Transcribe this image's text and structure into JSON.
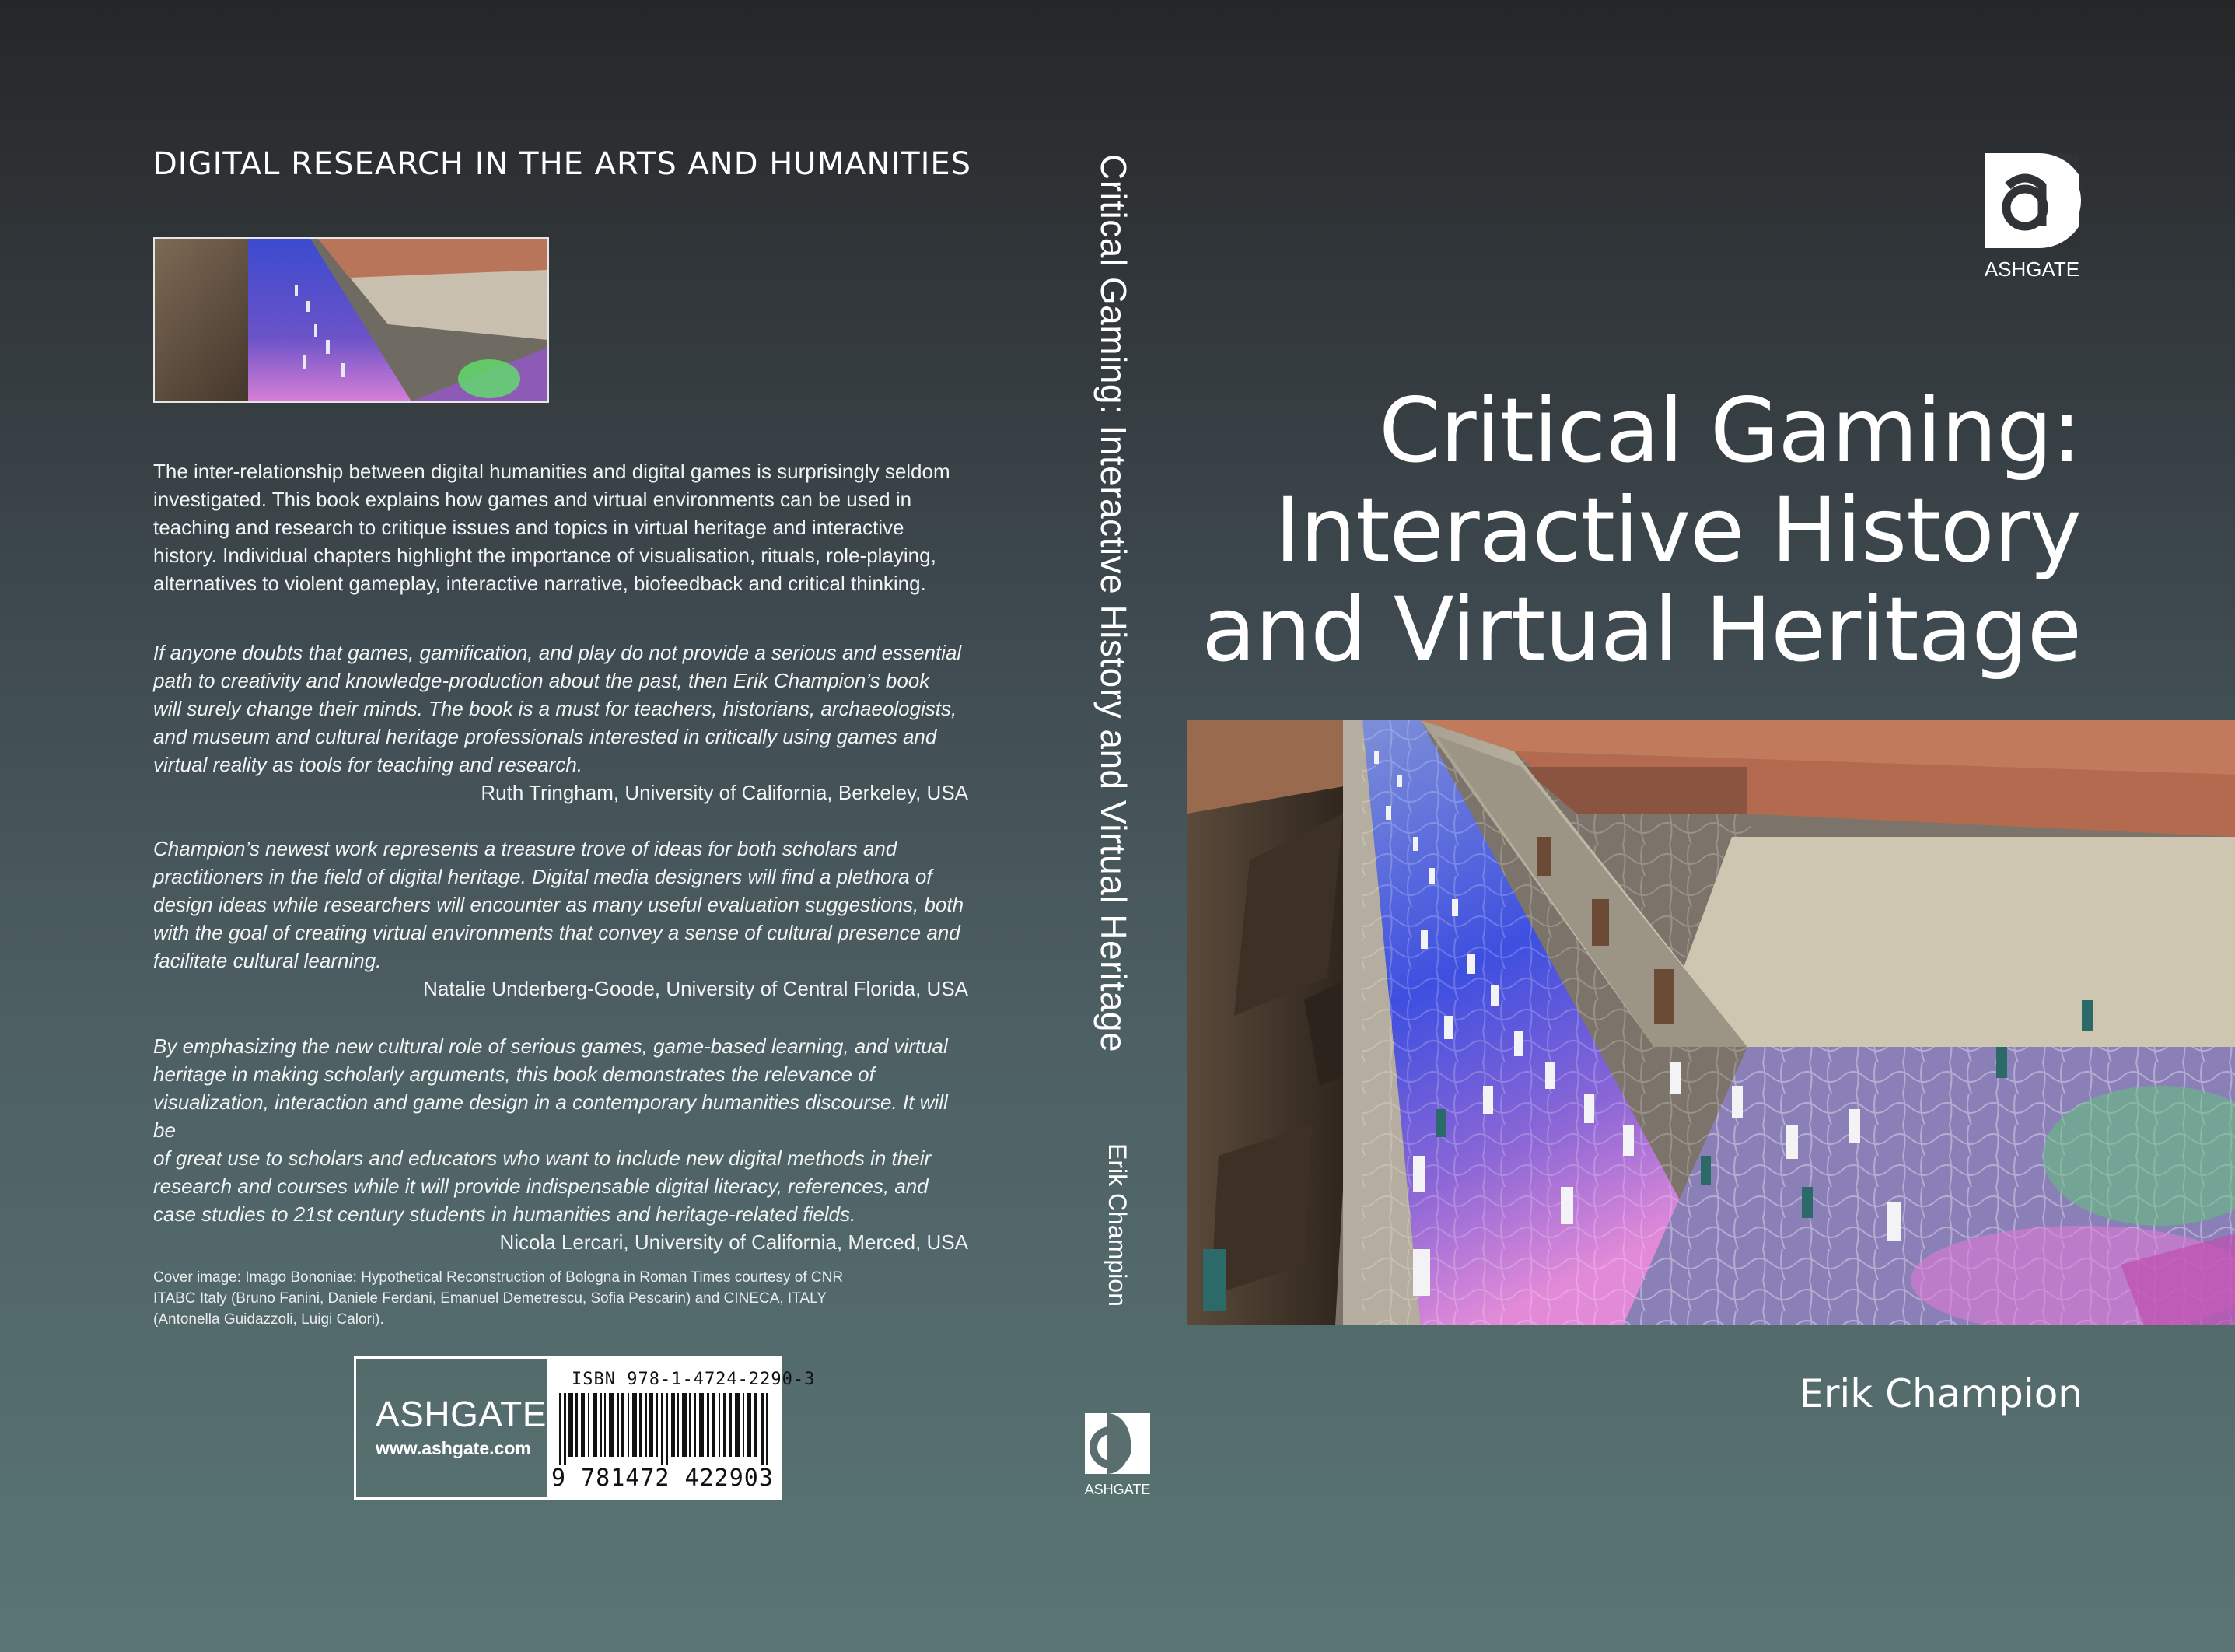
{
  "back": {
    "series": "DIGITAL RESEARCH IN THE ARTS AND HUMANITIES",
    "intro_lines": [
      "The inter-relationship between digital humanities and digital games is surprisingly seldom",
      "investigated. This book explains how games and virtual environments can be used in",
      "teaching and research to critique issues and topics in virtual heritage and interactive",
      "history. Individual chapters highlight the importance of visualisation, rituals, role-playing,",
      "alternatives to violent gameplay, interactive narrative, biofeedback and critical thinking."
    ],
    "quotes": [
      {
        "lines": [
          "If anyone doubts that games, gamification, and play do not provide a serious and essential",
          "path to creativity and knowledge-production about the past, then Erik Champion’s book",
          "will surely change their minds. The book is a must for teachers, historians, archaeologists,",
          "and museum and cultural heritage professionals interested in critically using games and",
          "virtual reality as tools for teaching and research."
        ],
        "attribution": "Ruth Tringham, University of California, Berkeley, USA"
      },
      {
        "lines": [
          "Champion’s newest work represents a treasure trove of ideas for both scholars and",
          "practitioners in the field of digital heritage. Digital media designers will find a plethora of",
          "design ideas while researchers will encounter as many useful evaluation suggestions, both",
          "with the goal of creating virtual environments that convey a sense of cultural presence and",
          "facilitate cultural learning."
        ],
        "attribution": "Natalie Underberg-Goode, University of Central Florida, USA"
      },
      {
        "lines": [
          "By emphasizing the new cultural role of serious games, game-based learning, and virtual",
          "heritage in making scholarly arguments, this book demonstrates the relevance of",
          "visualization, interaction and game design in a contemporary humanities discourse. It will be",
          "of great use to scholars and educators who want to include new digital methods in their",
          "research and courses while it will provide indispensable digital literacy, references, and",
          "case studies to 21st century students in humanities and heritage-related fields."
        ],
        "attribution": "Nicola Lercari, University of California, Merced, USA"
      }
    ],
    "credit_lines": [
      "Cover image: Imago Bononiae: Hypothetical Reconstruction of Bologna in Roman Times courtesy of CNR",
      "ITABC Italy (Bruno Fanini, Daniele Ferdani, Emanuel Demetrescu, Sofia Pescarin) and CINECA, ITALY",
      "(Antonella Guidazzoli, Luigi Calori)."
    ],
    "publisher": "ASHGATE",
    "publisher_url": "www.ashgate.com",
    "isbn_label": "ISBN 978-1-4724-2290-3",
    "isbn_digits": "9 781472 422903"
  },
  "spine": {
    "title": "Critical Gaming: Interactive History and Virtual Heritage",
    "author": "Erik Champion",
    "logo_text": "ASHGATE"
  },
  "front": {
    "logo_text": "ASHGATE",
    "title_lines": [
      "Critical Gaming:",
      "Interactive History",
      "and Virtual Heritage"
    ],
    "author": "Erik Champion"
  },
  "colors": {
    "background_top": "#252628",
    "background_bottom": "#5a7574",
    "text": "#ffffff"
  }
}
